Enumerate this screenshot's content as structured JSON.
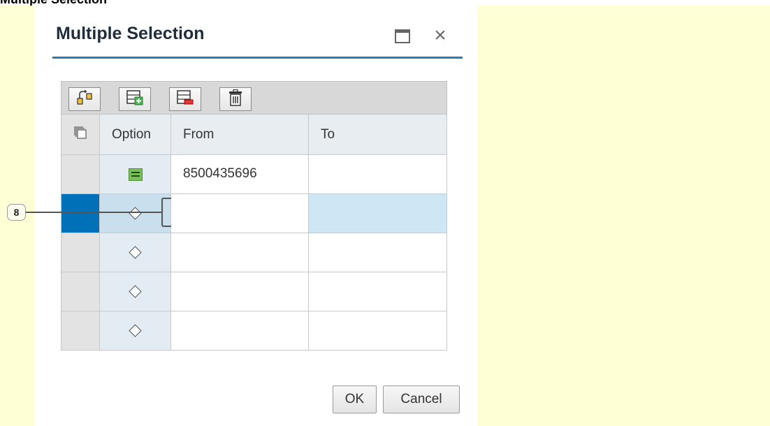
{
  "page_heading": "Multiple Selection",
  "dialog": {
    "title": "Multiple Selection",
    "close_glyph": "×"
  },
  "toolbar": {
    "buttons": [
      {
        "icon": "copy-to-clipboard-icon"
      },
      {
        "icon": "insert-row-icon"
      },
      {
        "icon": "delete-row-icon"
      },
      {
        "icon": "delete-all-icon"
      }
    ]
  },
  "table": {
    "columns": [
      "Option",
      "From",
      "To"
    ],
    "rows": [
      {
        "option": "equals",
        "from": "8500435696",
        "to": ""
      },
      {
        "option": "empty",
        "from": "",
        "to": ""
      },
      {
        "option": "empty",
        "from": "",
        "to": ""
      },
      {
        "option": "empty",
        "from": "",
        "to": ""
      },
      {
        "option": "empty",
        "from": "",
        "to": ""
      }
    ]
  },
  "callout": {
    "label": "8"
  },
  "footer": {
    "ok_label": "OK",
    "cancel_label": "Cancel"
  },
  "colors": {
    "accent": "#2c7bb6",
    "selected_row": "#0070b8",
    "highlight_bg": "#ffffd6",
    "equals_green": "#7ac05a"
  }
}
